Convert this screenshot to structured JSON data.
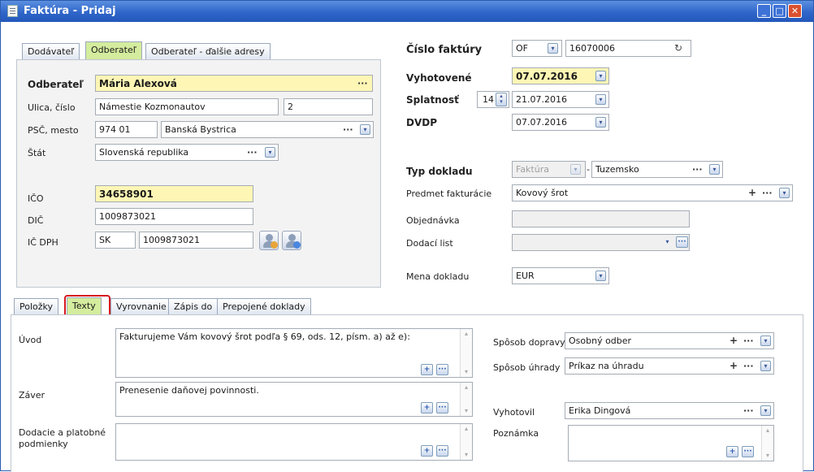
{
  "window": {
    "title": "Faktúra - Pridaj"
  },
  "partner_tabs": [
    {
      "label": "Dodávateľ"
    },
    {
      "label": "Odberateľ"
    },
    {
      "label": "Odberateľ - ďalšie adresy"
    }
  ],
  "customer": {
    "name_label": "Odberateľ",
    "name": "Mária Alexová",
    "street_label": "Ulica, číslo",
    "street": "Námestie Kozmonautov",
    "number": "2",
    "zip_label": "PSČ, mesto",
    "zip": "974 01",
    "city": "Banská Bystrica",
    "country_label": "Štát",
    "country": "Slovenská republika",
    "ico_label": "IČO",
    "ico": "34658901",
    "dic_label": "DIČ",
    "dic": "1009873021",
    "icdph_label": "IČ DPH",
    "icdph_prefix": "SK",
    "icdph": "1009873021"
  },
  "invoice": {
    "number_label": "Číslo faktúry",
    "series": "OF",
    "number": "16070006",
    "issued_label": "Vyhotovené",
    "issued": "07.07.2016",
    "due_label": "Splatnosť",
    "due_days": "14",
    "due": "21.07.2016",
    "dvdp_label": "DVDP",
    "dvdp": "07.07.2016",
    "doc_type_label": "Typ dokladu",
    "doc_type": "Faktúra",
    "doc_region": "Tuzemsko",
    "subject_label": "Predmet fakturácie",
    "subject": "Kovový šrot",
    "order_label": "Objednávka",
    "order": "",
    "delivery_note_label": "Dodací list",
    "delivery_note": "",
    "currency_label": "Mena dokladu",
    "currency": "EUR"
  },
  "detail_tabs": [
    {
      "label": "Položky"
    },
    {
      "label": "Texty"
    },
    {
      "label": "Vyrovnanie"
    },
    {
      "label": "Zápis do"
    },
    {
      "label": "Prepojené doklady"
    }
  ],
  "texts": {
    "intro_label": "Úvod",
    "intro": "Fakturujeme Vám kovový šrot podľa § 69, ods. 12, písm. a) až e):",
    "closing_label": "Záver",
    "closing": "Prenesenie daňovej povinnosti.",
    "terms_label_1": "Dodacie a platobné",
    "terms_label_2": "podmienky",
    "terms": "",
    "shipping_label": "Spôsob dopravy",
    "shipping": "Osobný odber",
    "payment_label": "Spôsob úhrady",
    "payment": "Príkaz na úhradu",
    "issuer_label": "Vyhotovil",
    "issuer": "Erika Dingová",
    "note_label": "Poznámka",
    "note": ""
  },
  "glyphs": {
    "dots": "···",
    "plus": "+",
    "down": "▾",
    "up": "▴",
    "refresh": "↻"
  },
  "colors": {
    "title_bar": "#2f66c9",
    "active_tab": "#d4ec9e",
    "required_field": "#fdf6b5",
    "highlight": "#d6191f"
  }
}
